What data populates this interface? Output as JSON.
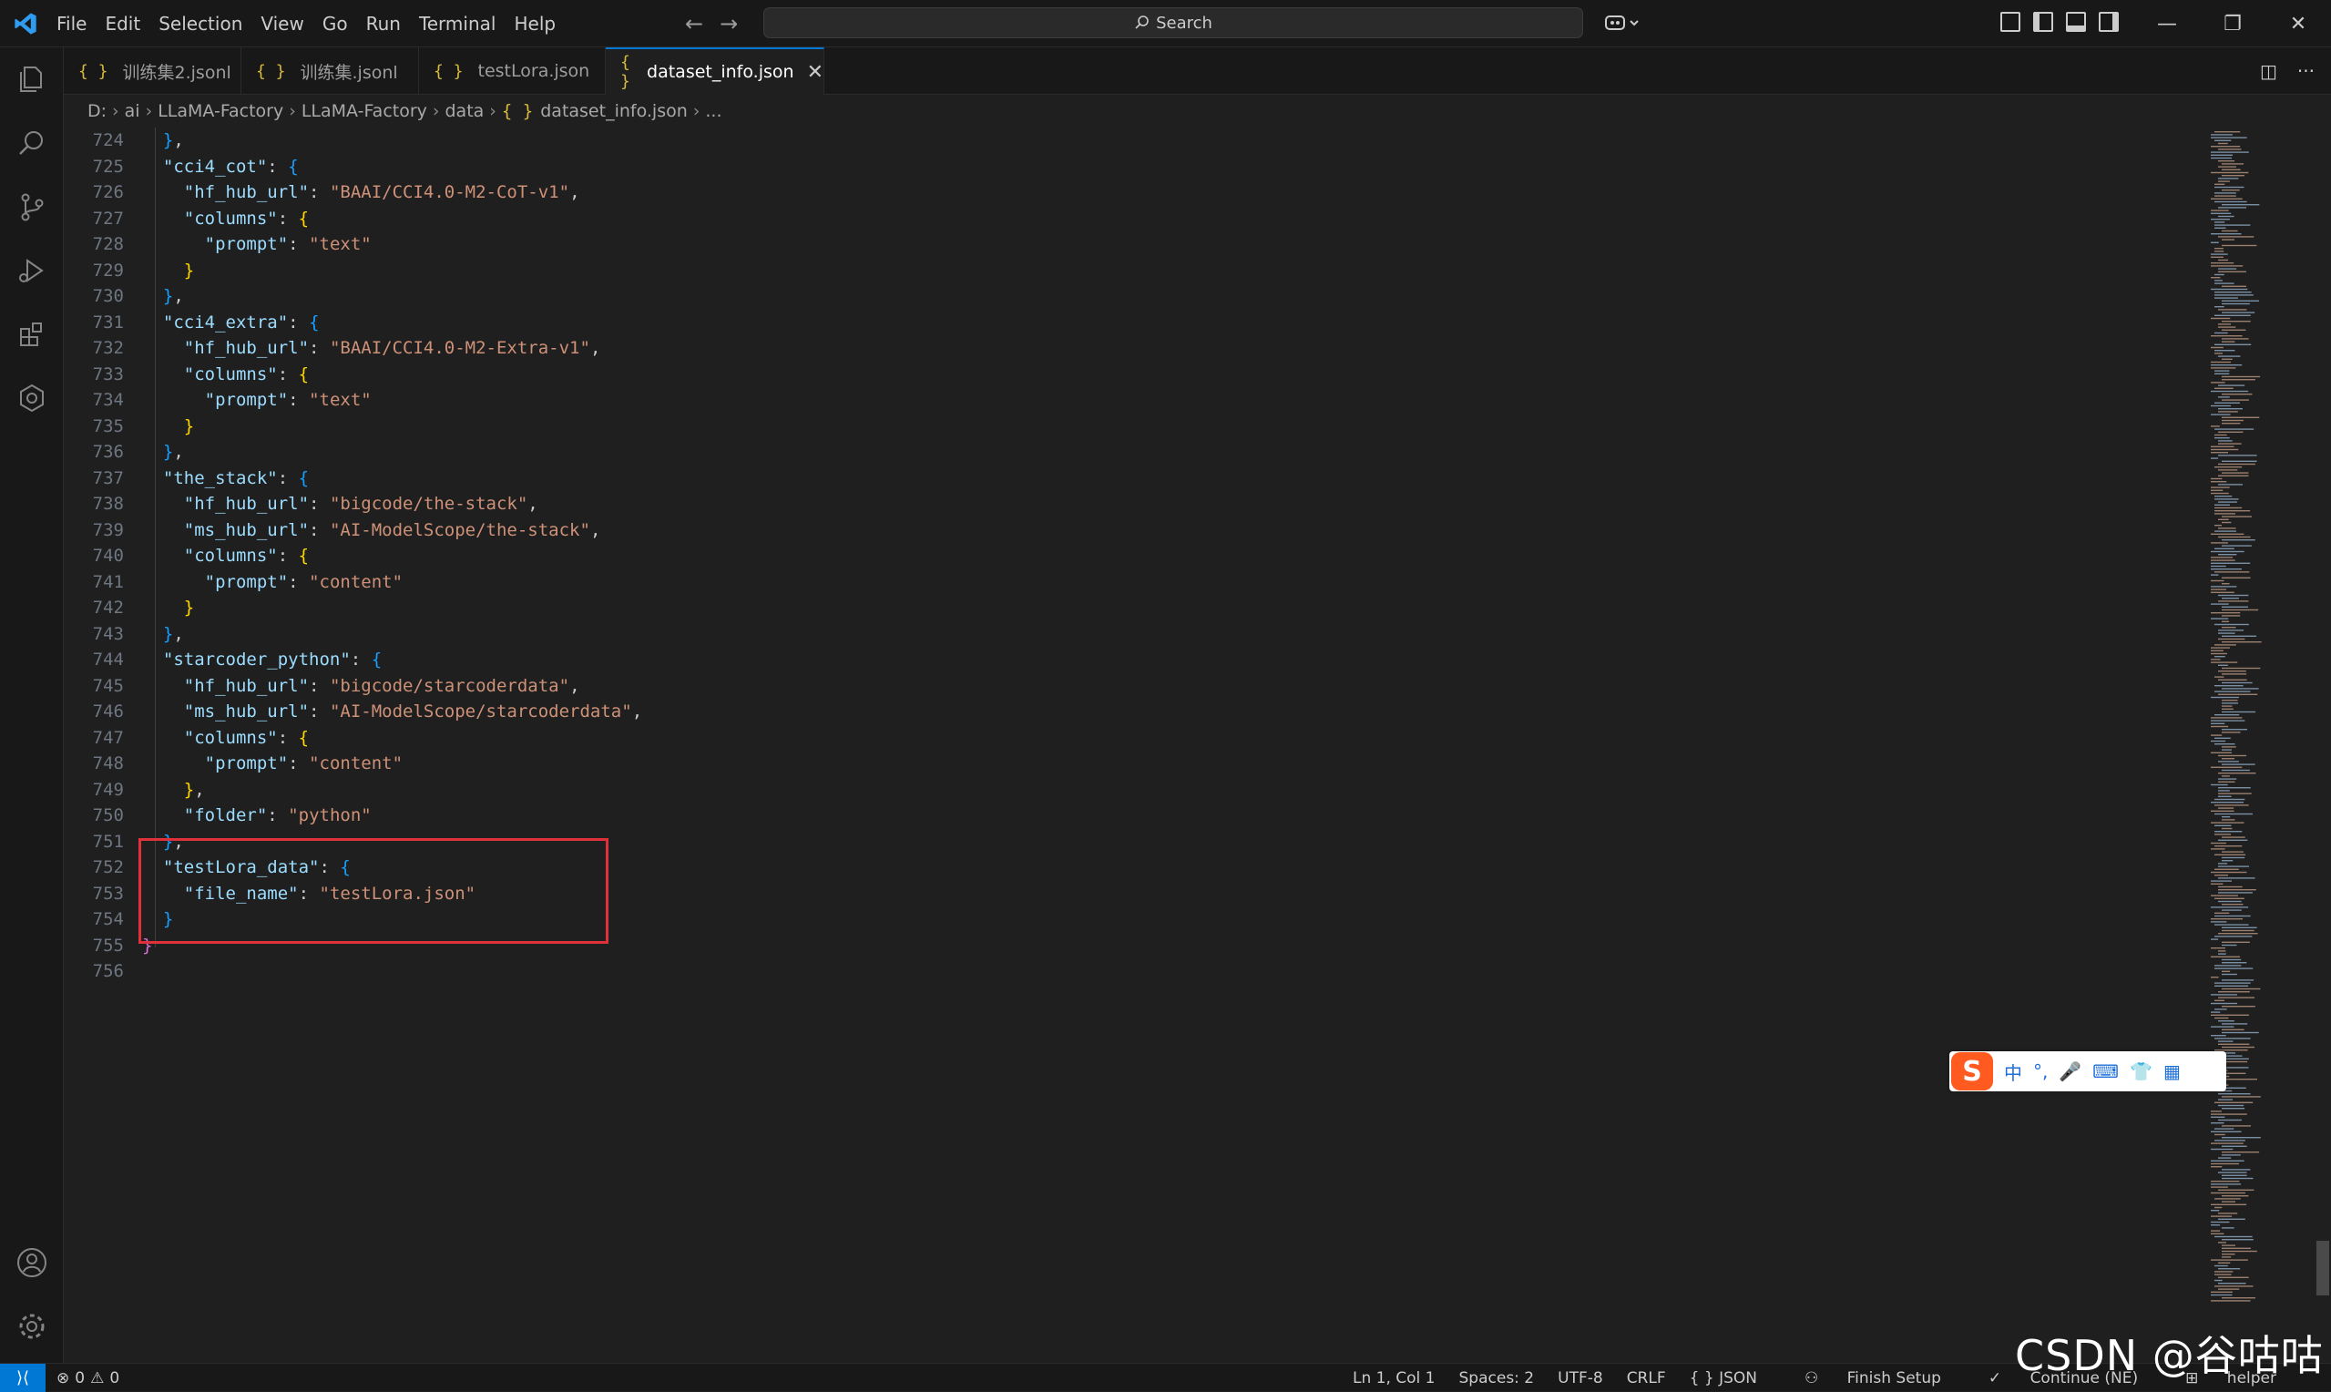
{
  "titlebar": {
    "menu": [
      "File",
      "Edit",
      "Selection",
      "View",
      "Go",
      "Run",
      "Terminal",
      "Help"
    ],
    "search_placeholder": "Search"
  },
  "tabs": [
    {
      "label": "训练集2.jsonl",
      "active": false
    },
    {
      "label": "训练集.jsonl",
      "active": false
    },
    {
      "label": "testLora.json",
      "active": false
    },
    {
      "label": "dataset_info.json",
      "active": true
    }
  ],
  "tab_close_glyph": "✕",
  "breadcrumb": [
    "D:",
    "ai",
    "LLaMA-Factory",
    "LLaMA-Factory",
    "data",
    "dataset_info.json",
    "..."
  ],
  "editor": {
    "language": "json",
    "lines": [
      {
        "n": "724",
        "text": "  },"
      },
      {
        "n": "725",
        "text": "  \"cci4_cot\": {"
      },
      {
        "n": "726",
        "text": "    \"hf_hub_url\": \"BAAI/CCI4.0-M2-CoT-v1\","
      },
      {
        "n": "727",
        "text": "    \"columns\": {"
      },
      {
        "n": "728",
        "text": "      \"prompt\": \"text\""
      },
      {
        "n": "729",
        "text": "    }"
      },
      {
        "n": "730",
        "text": "  },"
      },
      {
        "n": "731",
        "text": "  \"cci4_extra\": {"
      },
      {
        "n": "732",
        "text": "    \"hf_hub_url\": \"BAAI/CCI4.0-M2-Extra-v1\","
      },
      {
        "n": "733",
        "text": "    \"columns\": {"
      },
      {
        "n": "734",
        "text": "      \"prompt\": \"text\""
      },
      {
        "n": "735",
        "text": "    }"
      },
      {
        "n": "736",
        "text": "  },"
      },
      {
        "n": "737",
        "text": "  \"the_stack\": {"
      },
      {
        "n": "738",
        "text": "    \"hf_hub_url\": \"bigcode/the-stack\","
      },
      {
        "n": "739",
        "text": "    \"ms_hub_url\": \"AI-ModelScope/the-stack\","
      },
      {
        "n": "740",
        "text": "    \"columns\": {"
      },
      {
        "n": "741",
        "text": "      \"prompt\": \"content\""
      },
      {
        "n": "742",
        "text": "    }"
      },
      {
        "n": "743",
        "text": "  },"
      },
      {
        "n": "744",
        "text": "  \"starcoder_python\": {"
      },
      {
        "n": "745",
        "text": "    \"hf_hub_url\": \"bigcode/starcoderdata\","
      },
      {
        "n": "746",
        "text": "    \"ms_hub_url\": \"AI-ModelScope/starcoderdata\","
      },
      {
        "n": "747",
        "text": "    \"columns\": {"
      },
      {
        "n": "748",
        "text": "      \"prompt\": \"content\""
      },
      {
        "n": "749",
        "text": "    },"
      },
      {
        "n": "750",
        "text": "    \"folder\": \"python\""
      },
      {
        "n": "751",
        "text": "  },"
      },
      {
        "n": "752",
        "text": "  \"testLora_data\": {"
      },
      {
        "n": "753",
        "text": "    \"file_name\": \"testLora.json\""
      },
      {
        "n": "754",
        "text": "  }"
      },
      {
        "n": "755",
        "text": "}"
      },
      {
        "n": "756",
        "text": ""
      }
    ]
  },
  "ime": {
    "glyphs": [
      "中",
      "°,",
      "🎤",
      "⌨",
      "👕",
      "▦"
    ]
  },
  "statusbar": {
    "remote_glyph": "⟩⟨",
    "errors": "0",
    "warnings": "0",
    "position": "Ln 1, Col 1",
    "spaces": "Spaces: 2",
    "encoding": "UTF-8",
    "eol": "CRLF",
    "language": "{ }  JSON",
    "finish_setup": "Finish Setup",
    "continue": "Continue (NE)",
    "helper": "helper"
  },
  "watermark": "CSDN @谷咕咕",
  "colors": {
    "accent": "#0078d4",
    "highlight_box": "#e0303a",
    "key": "#9cdcfe",
    "string": "#ce9178"
  }
}
